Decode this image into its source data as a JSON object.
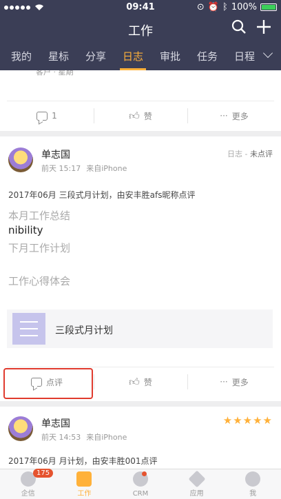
{
  "status_bar": {
    "time": "09:41",
    "battery": "100%"
  },
  "header": {
    "title": "工作"
  },
  "tabs": [
    "我的",
    "星标",
    "分享",
    "日志",
    "审批",
    "任务",
    "日程"
  ],
  "active_tab": "日志",
  "card0": {
    "cutoff_text": "客户 · 星期",
    "comment_label": "1",
    "like_label": "赞",
    "more_label": "更多"
  },
  "card1": {
    "name": "单志国",
    "time": "前天 15:17",
    "source": "来自iPhone",
    "type": "日志",
    "status": "未点评",
    "summary": "2017年06月 三段式月计划，由安丰胜afs昵称点评",
    "sections": [
      "本月工作总结",
      "nibility",
      "下月工作计划",
      "工作心得体会"
    ],
    "attachment": "三段式月计划",
    "comment_label": "点评",
    "like_label": "赞",
    "more_label": "更多"
  },
  "card2": {
    "name": "单志国",
    "time": "前天 14:53",
    "source": "来自iPhone",
    "rating": 5,
    "summary": "2017年06月 月计划，由安丰胜001点评"
  },
  "tabbar": [
    {
      "label": "企信",
      "badge": "175"
    },
    {
      "label": "工作"
    },
    {
      "label": "CRM"
    },
    {
      "label": "应用"
    },
    {
      "label": "我"
    }
  ],
  "colors": {
    "header": "#3b3e56",
    "accent": "#ffb13a",
    "badge": "#e5532f"
  }
}
